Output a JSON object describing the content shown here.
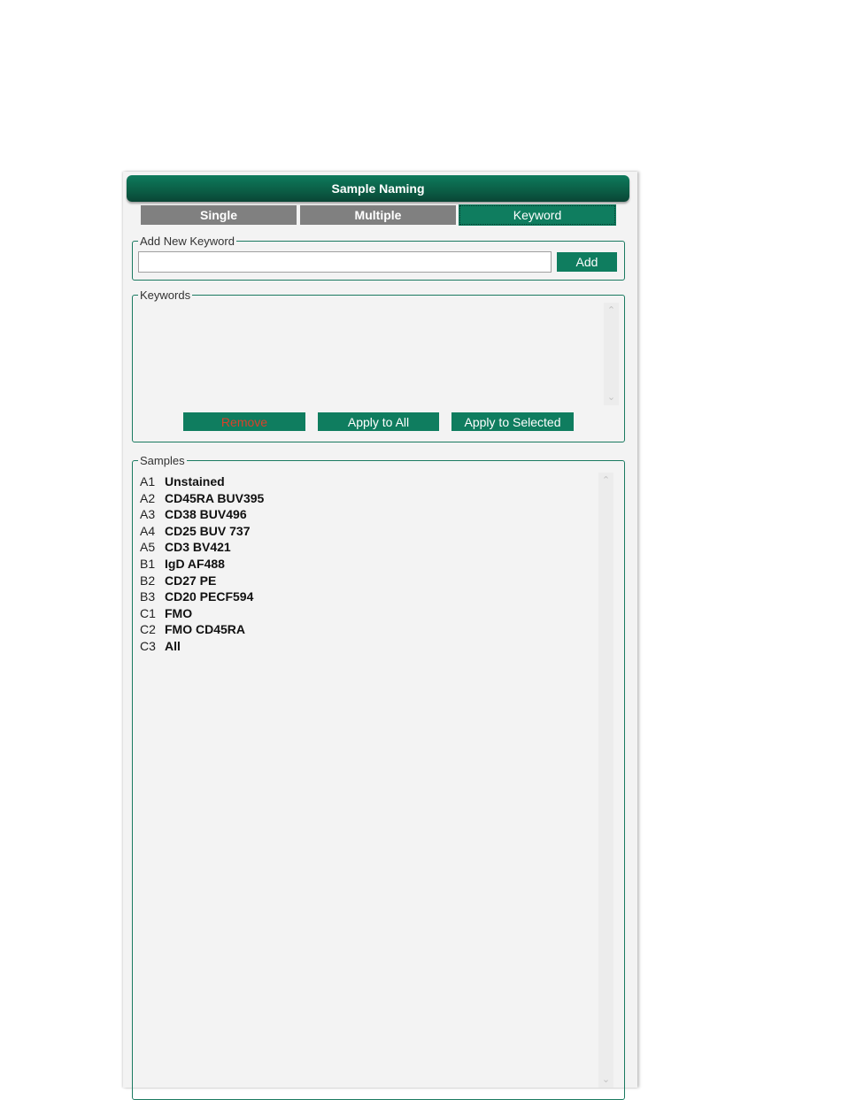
{
  "window": {
    "title": "Sample Naming"
  },
  "tabs": [
    {
      "label": "Single",
      "active": false
    },
    {
      "label": "Multiple",
      "active": false
    },
    {
      "label": "Keyword",
      "active": true
    }
  ],
  "add_keyword": {
    "group_label": "Add New Keyword",
    "input_value": "",
    "add_label": "Add"
  },
  "keywords": {
    "group_label": "Keywords",
    "items": [],
    "remove_label": "Remove",
    "apply_all_label": "Apply to All",
    "apply_selected_label": "Apply to Selected"
  },
  "samples": {
    "group_label": "Samples",
    "items": [
      {
        "well": "A1",
        "name": "Unstained"
      },
      {
        "well": "A2",
        "name": "CD45RA BUV395"
      },
      {
        "well": "A3",
        "name": "CD38 BUV496"
      },
      {
        "well": "A4",
        "name": "CD25 BUV 737"
      },
      {
        "well": "A5",
        "name": "CD3 BV421"
      },
      {
        "well": "B1",
        "name": "IgD AF488"
      },
      {
        "well": "B2",
        "name": "CD27 PE"
      },
      {
        "well": "B3",
        "name": "CD20 PECF594"
      },
      {
        "well": "C1",
        "name": "FMO"
      },
      {
        "well": "C2",
        "name": "FMO CD45RA"
      },
      {
        "well": "C3",
        "name": "All"
      }
    ]
  },
  "colors": {
    "accent": "#0f7d5f",
    "inactive_tab": "#808080",
    "remove_text": "#d9412a"
  },
  "icons": {
    "scroll_up": "chevron-up-icon",
    "scroll_down": "chevron-down-icon"
  }
}
